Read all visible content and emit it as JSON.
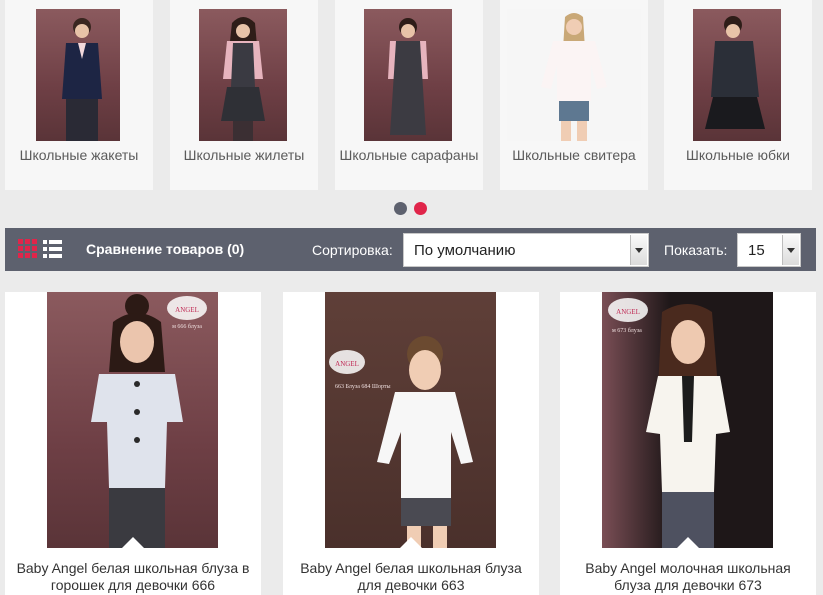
{
  "categories": [
    {
      "label": "Школьные жакеты"
    },
    {
      "label": "Школьные жилеты"
    },
    {
      "label": "Школьные сарафаны"
    },
    {
      "label": "Школьные свитера"
    },
    {
      "label": "Школьные юбки"
    }
  ],
  "carousel_dots": {
    "inactive_color": "#5d616e",
    "active_color": "#e0254a"
  },
  "toolbar": {
    "compare_label": "Сравнение товаров (0)",
    "sort_label": "Сортировка:",
    "sort_value": "По умолчанию",
    "show_label": "Показать:",
    "show_value": "15"
  },
  "products": [
    {
      "title": "Baby Angel белая школьная блуза в горошек для девочки 666",
      "photo_caption": "м 666 блуза",
      "brand": "ANGEL"
    },
    {
      "title": "Baby Angel белая школьная блуза для девочки 663",
      "photo_caption": "663 Блуза 684 Шорты",
      "brand": "ANGEL"
    },
    {
      "title": "Baby Angel молочная школьная блуза для девочки 673",
      "photo_caption": "м 673 блуза",
      "brand": "ANGEL"
    }
  ],
  "colors": {
    "toolbar": "#5d616e",
    "accent": "#e0254a",
    "background": "#ebebeb"
  }
}
